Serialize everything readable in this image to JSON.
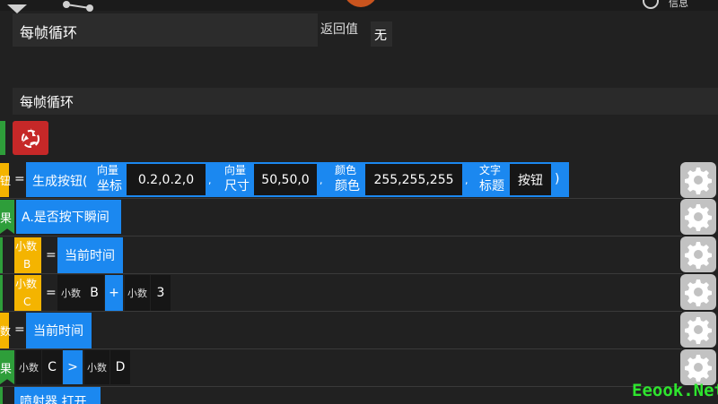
{
  "header": {
    "function_name": "每帧循环",
    "return_label": "返回值",
    "return_value": "无",
    "info_label": "信息"
  },
  "section": {
    "title": "每帧循环"
  },
  "rows": {
    "r1": {
      "var_label": "钮",
      "op": "=",
      "func": "生成按钮(",
      "p1_type": "向量",
      "p1_name": "坐标",
      "p1_value": "0.2,0.2,0",
      "sep1": ",",
      "p2_type": "向量",
      "p2_name": "尺寸",
      "p2_value": "50,50,0",
      "sep2": ",",
      "p3_type": "颜色",
      "p3_name": "颜色",
      "p3_value": "255,255,255",
      "sep3": ",",
      "p4_type": "文字",
      "p4_name": "标题",
      "p4_value": "按钮",
      "close": ")"
    },
    "r2": {
      "cond_label": "果",
      "expr": "A.是否按下瞬间"
    },
    "r3": {
      "type": "小数",
      "var": "B",
      "op": "=",
      "expr": "当前时间"
    },
    "r4": {
      "type": "小数",
      "var": "C",
      "op": "=",
      "a_type": "小数",
      "a_var": "B",
      "plus": "+",
      "b_type": "小数",
      "b_val": "3"
    },
    "r5": {
      "var_label": "数",
      "op": "=",
      "expr": "当前时间"
    },
    "r6": {
      "cond_label": "果",
      "a_type": "小数",
      "a_var": "C",
      "cmp": ">",
      "b_type": "小数",
      "b_var": "D"
    },
    "r7": {
      "expr": "喷射器.打开"
    }
  },
  "watermark": "Eeook.Net"
}
